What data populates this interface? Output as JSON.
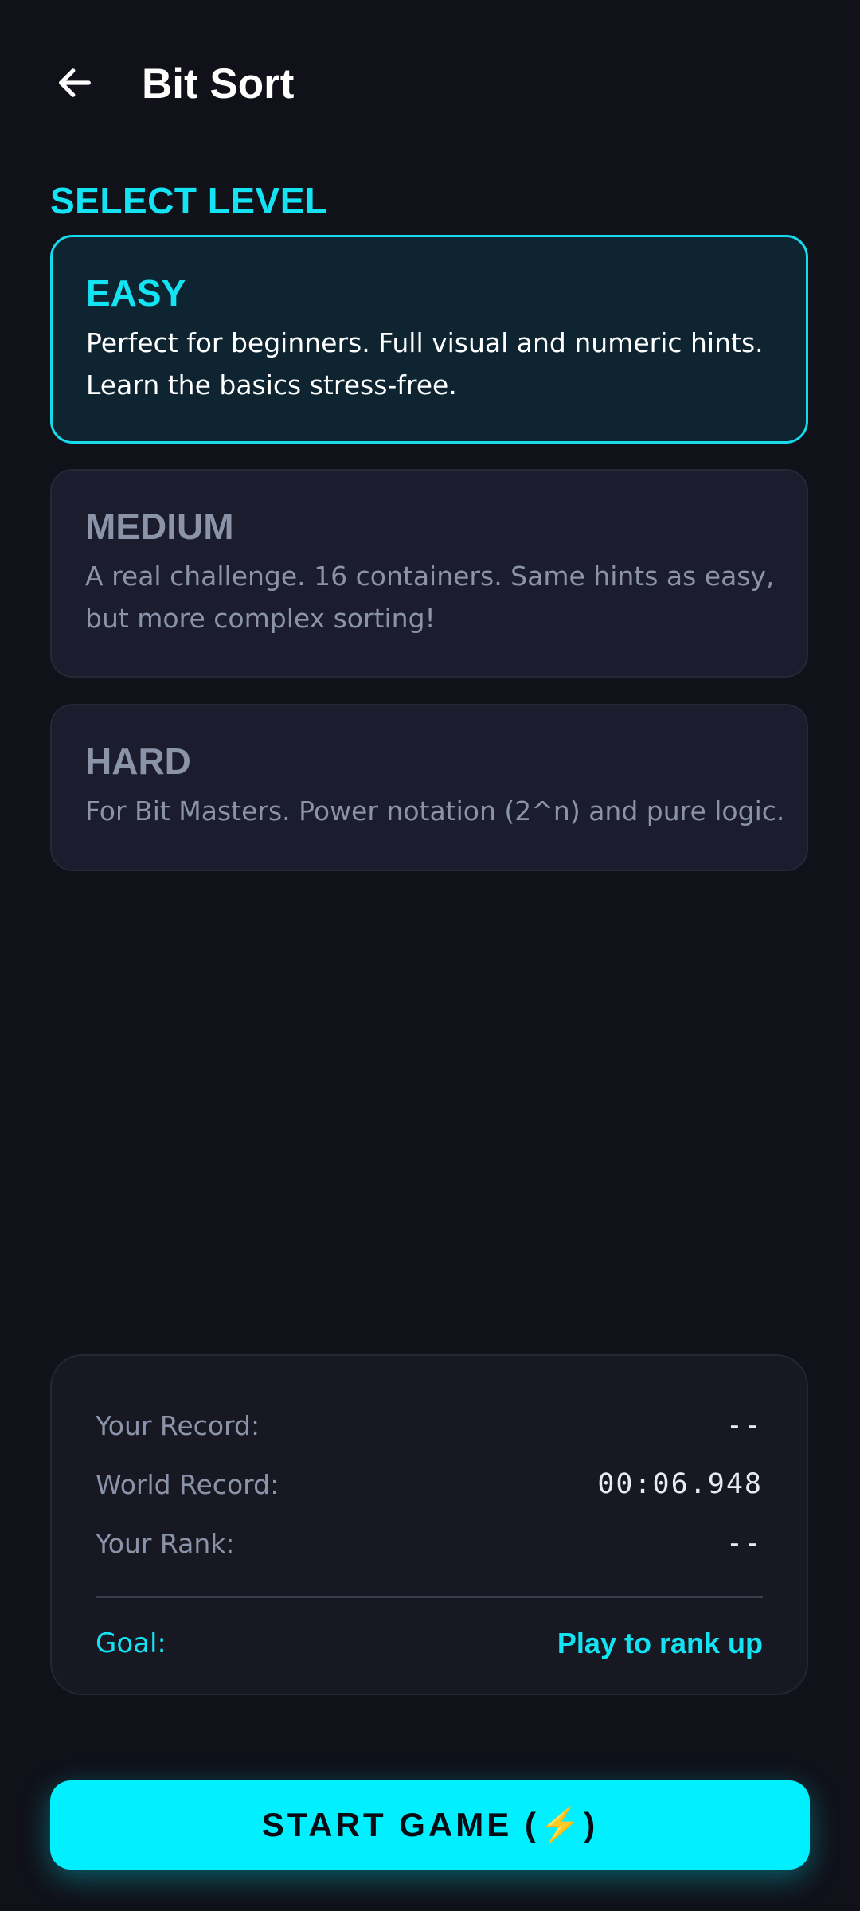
{
  "header": {
    "back_icon": "arrow-left-icon",
    "title": "Bit Sort"
  },
  "select_level": {
    "label": "SELECT LEVEL",
    "levels": [
      {
        "name": "EASY",
        "desc_line1": "Perfect for beginners. Full visual and numeric hints.",
        "desc_line2": "Learn the basics stress-free.",
        "selected": true
      },
      {
        "name": "MEDIUM",
        "desc_line1": "A real challenge. 16 containers. Same hints as easy,",
        "desc_line2": "but more complex sorting!",
        "selected": false
      },
      {
        "name": "HARD",
        "desc_line1": "For Bit Masters. Power notation (2^n) and pure logic.",
        "selected": false
      }
    ]
  },
  "stats": {
    "your_record_label": "Your Record:",
    "your_record_value": "--",
    "world_record_label": "World Record:",
    "world_record_value": "00:06.948",
    "your_rank_label": "Your Rank:",
    "your_rank_value": "--",
    "goal_label": "Goal:",
    "goal_value": "Play to rank up"
  },
  "start_button": {
    "label": "START GAME (⚡)"
  },
  "colors": {
    "background": "#101119",
    "accent": "#13e3f2",
    "button": "#00f0ff",
    "muted_text": "#8b93a8",
    "card": "#1b1c2e",
    "selected_card": "#0f2431"
  }
}
